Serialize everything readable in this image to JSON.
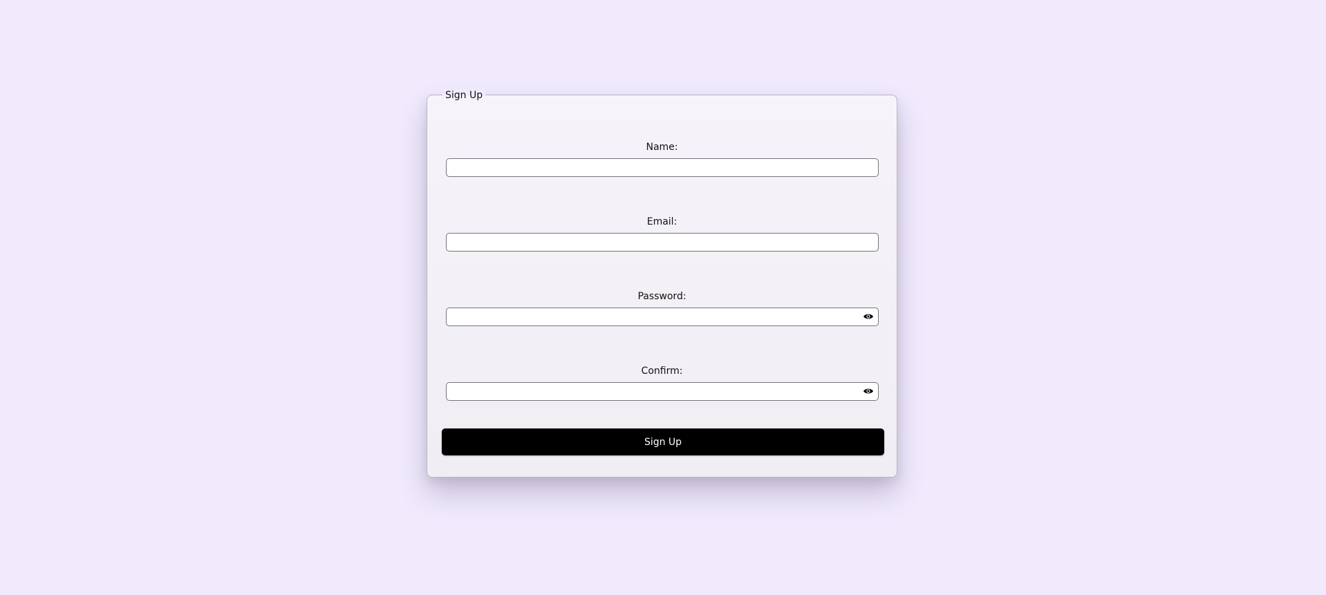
{
  "colors": {
    "background": "#f1eafd",
    "card": "#f3f1f6",
    "button": "#000000",
    "button_text": "#ffffff"
  },
  "form": {
    "legend": "Sign Up",
    "fields": [
      {
        "label": "Name:",
        "value": "",
        "placeholder": "",
        "type": "text"
      },
      {
        "label": "Email:",
        "value": "",
        "placeholder": "",
        "type": "email"
      },
      {
        "label": "Password:",
        "value": "",
        "placeholder": "",
        "type": "password",
        "icon": "eye-icon"
      },
      {
        "label": "Confirm:",
        "value": "",
        "placeholder": "",
        "type": "password",
        "icon": "eye-icon"
      }
    ],
    "submit_label": "Sign Up"
  }
}
